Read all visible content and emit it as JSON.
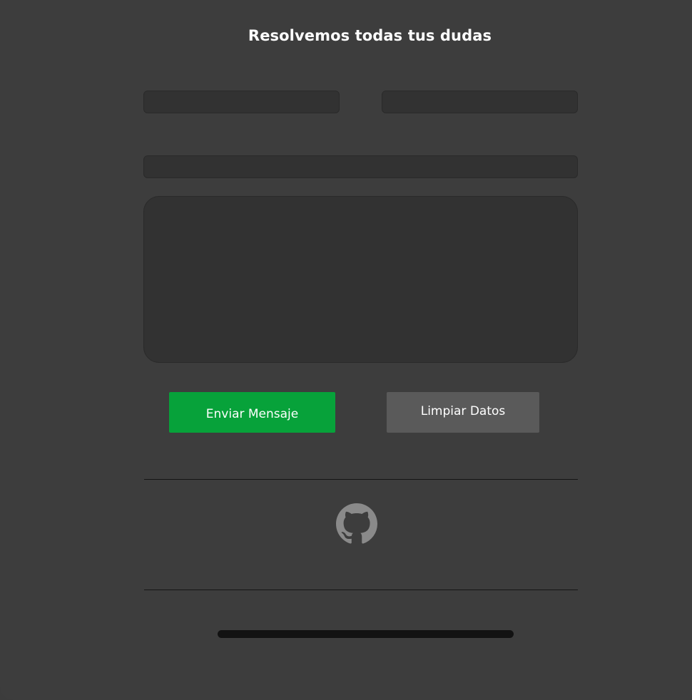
{
  "form": {
    "title": "Resolvemos todas tus dudas",
    "fields": {
      "first_name": {
        "value": "",
        "placeholder": ""
      },
      "last_name": {
        "value": "",
        "placeholder": ""
      },
      "email": {
        "value": "",
        "placeholder": ""
      },
      "message": {
        "value": "",
        "placeholder": ""
      }
    },
    "buttons": {
      "send_label": "Enviar Mensaje",
      "clear_label": "Limpiar Datos"
    }
  },
  "footer": {
    "icon": "github-icon"
  },
  "colors": {
    "background": "#3d3d3d",
    "input_background": "#323232",
    "send_button": "#07a23a",
    "clear_button": "#5a5a5a",
    "icon": "#8a8a8a",
    "divider": "#151515"
  }
}
